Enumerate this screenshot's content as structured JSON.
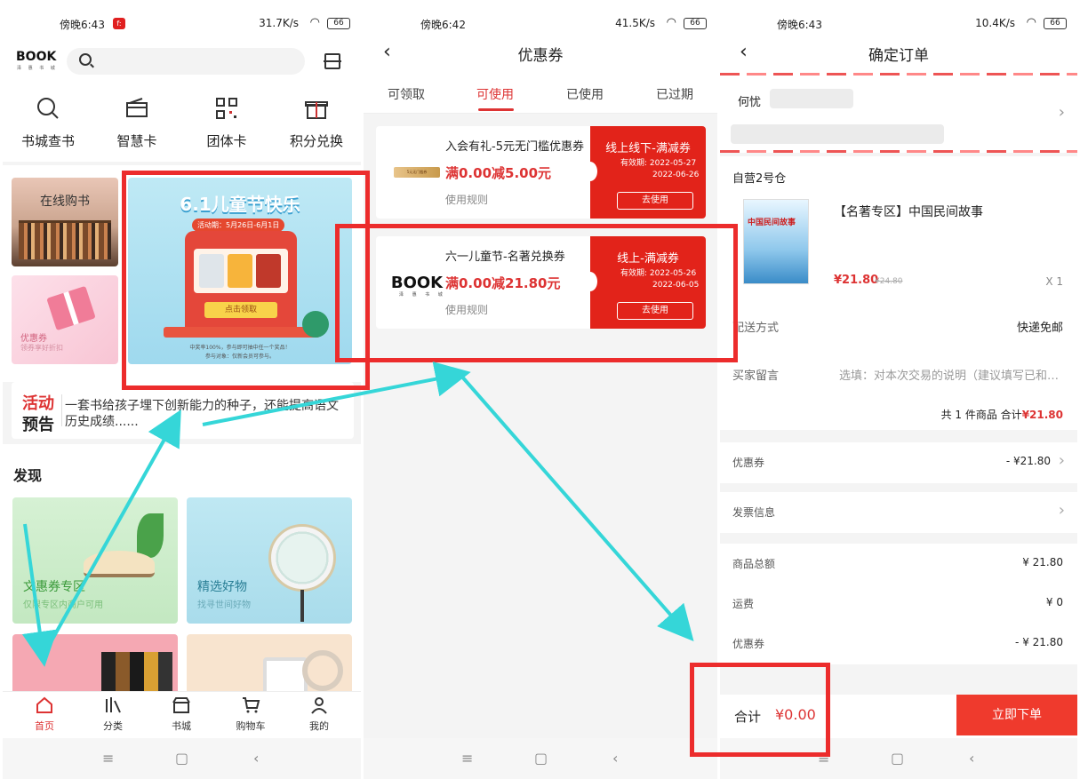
{
  "status": {
    "p1": {
      "time": "傍晚6:43",
      "net": "31.7K/s",
      "battery": "66",
      "notif": "f:"
    },
    "p2": {
      "time": "傍晚6:42",
      "net": "41.5K/s",
      "battery": "66"
    },
    "p3": {
      "time": "傍晚6:43",
      "net": "10.4K/s",
      "battery": "66"
    }
  },
  "home": {
    "logo": "BOOK",
    "logo_sub": "泽 惠 书 城",
    "quick": [
      {
        "label": "书城查书",
        "icon": "search-icon"
      },
      {
        "label": "智慧卡",
        "icon": "card-icon"
      },
      {
        "label": "团体卡",
        "icon": "qrcode-icon"
      },
      {
        "label": "积分兑换",
        "icon": "gift-icon"
      }
    ],
    "online": "在线购书",
    "coupon_card": {
      "title": "优惠券",
      "sub": "领券享好折扣"
    },
    "banner": {
      "title": "6.1儿童节快乐",
      "sub": "活动期：5月26日-6月1日",
      "btn": "点击领取",
      "foot1": "中奖率100%，参与即可抽中任一个奖品！",
      "foot2": "参与对象：仅新会员可参与。"
    },
    "activity": {
      "tag1": "活动",
      "tag2": "预告",
      "text": "一套书给孩子埋下创新能力的种子，还能提高语文历史成绩......"
    },
    "discover": {
      "heading": "发现",
      "cards": [
        {
          "title": "文惠券专区",
          "sub": "仅限专区内商户可用"
        },
        {
          "title": "精选好物",
          "sub": "找寻世间好物"
        }
      ]
    },
    "tabs": [
      {
        "label": "首页",
        "icon": "home-icon"
      },
      {
        "label": "分类",
        "icon": "category-icon"
      },
      {
        "label": "书城",
        "icon": "store-icon"
      },
      {
        "label": "购物车",
        "icon": "cart-icon"
      },
      {
        "label": "我的",
        "icon": "user-icon"
      }
    ]
  },
  "coupons": {
    "title": "优惠券",
    "tabs": [
      "可领取",
      "可使用",
      "已使用",
      "已过期"
    ],
    "active_tab": "可使用",
    "items": [
      {
        "name": "入会有礼-5元无门槛优惠券",
        "amount": "满0.00减5.00元",
        "rule": "使用规则",
        "kind": "线上线下-满减券",
        "validity": "有效期:",
        "date1": "2022-05-27",
        "date2": "2022-06-26",
        "use": "去使用",
        "thumb": "5元无门槛券"
      },
      {
        "name": "六一儿童节-名著兑换券",
        "amount": "满0.00减21.80元",
        "rule": "使用规则",
        "kind": "线上-满减券",
        "validity": "有效期:",
        "date1": "2022-05-26",
        "date2": "2022-06-05",
        "use": "去使用",
        "thumb": "BOOK"
      }
    ]
  },
  "order": {
    "title": "确定订单",
    "name": "何忧",
    "warehouse": "自营2号仓",
    "book_title": "【名著专区】中国民间故事",
    "cover_text": "中国民间故事",
    "price": "¥21.80",
    "orig_price": "¥24.80",
    "qty": "X 1",
    "delivery_label": "配送方式",
    "delivery_value": "快递免邮",
    "note_label": "买家留言",
    "note_placeholder": "选填：对本次交易的说明（建议填写已和卖家协商一致的内容）",
    "sum_prefix": "共 1 件商品 合计",
    "sum_value": "¥21.80",
    "coupon_label": "优惠券",
    "coupon_value": "- ¥21.80",
    "invoice_label": "发票信息",
    "totals": [
      {
        "label": "商品总额",
        "value": "¥ 21.80"
      },
      {
        "label": "运费",
        "value": "¥ 0"
      },
      {
        "label": "优惠券",
        "value": "- ¥ 21.80"
      }
    ],
    "total_label": "合计",
    "total_value": "¥0.00",
    "submit": "立即下单"
  },
  "colors": {
    "accent": "#e2231a",
    "highlight": "#ec2c2c",
    "arrow": "#35d6d8"
  }
}
